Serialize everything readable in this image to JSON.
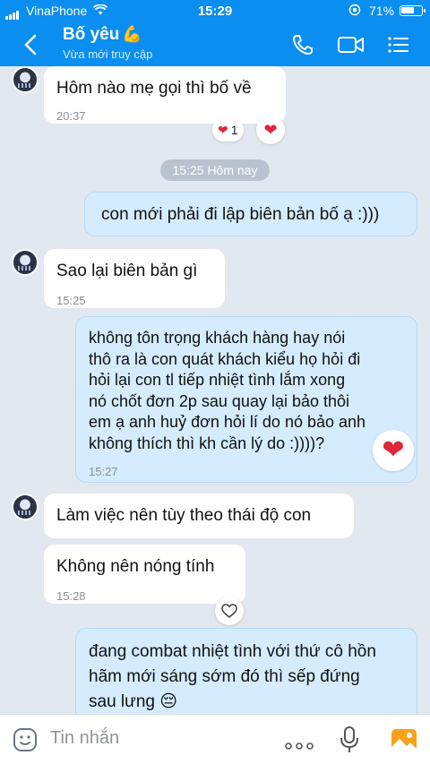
{
  "status_bar": {
    "carrier": "VinaPhone",
    "time": "15:29",
    "battery": "71%",
    "battery_level": 0.71
  },
  "header": {
    "contact_name": "Bố yêu",
    "contact_emoji": "💪",
    "contact_status": "Vừa mới truy cập",
    "icons": [
      "back-arrow-icon",
      "phone-icon",
      "video-camera-icon",
      "menu-list-icon"
    ],
    "accent_color": "#0a8eef"
  },
  "messages": [
    {
      "side": "in",
      "text": "Hôm nào mẹ gọi thì bố về",
      "time": "20:37",
      "reaction": "❤",
      "reaction_count": "1"
    },
    {
      "side": "divider",
      "text": "15:25 Hôm nay"
    },
    {
      "side": "out",
      "text": "con mới phải đi lập biên bản bố ạ :)))"
    },
    {
      "side": "in",
      "text": "Sao lại biên bản gì",
      "time": "15:25"
    },
    {
      "side": "out",
      "lines": [
        "không tôn trọng khách hàng hay nói",
        "thô ra là con quát khách kiểu họ hỏi đi",
        "hỏi lại con tl tiếp nhiệt tình lắm xong",
        "nó chốt đơn 2p sau quay lại bảo thôi",
        "em ạ anh huỷ đơn hỏi lí do nó bảo anh",
        "không thích thì kh cần lý do :))))?"
      ],
      "time": "15:27",
      "reaction": "❤"
    },
    {
      "side": "in",
      "text": "Làm việc nên tùy theo thái độ con"
    },
    {
      "side": "in",
      "text": "Không nên nóng tính",
      "time": "15:28"
    },
    {
      "side": "out",
      "lines": [
        "đang combat nhiệt tình với thứ cô hồn",
        "hãm mới sáng sớm đó thì sếp đứng",
        "sau lưng 😔"
      ]
    }
  ],
  "input_bar": {
    "placeholder": "Tin nhắn",
    "icons": [
      "sticker-icon",
      "more-icon",
      "microphone-icon",
      "image-icon"
    ]
  }
}
